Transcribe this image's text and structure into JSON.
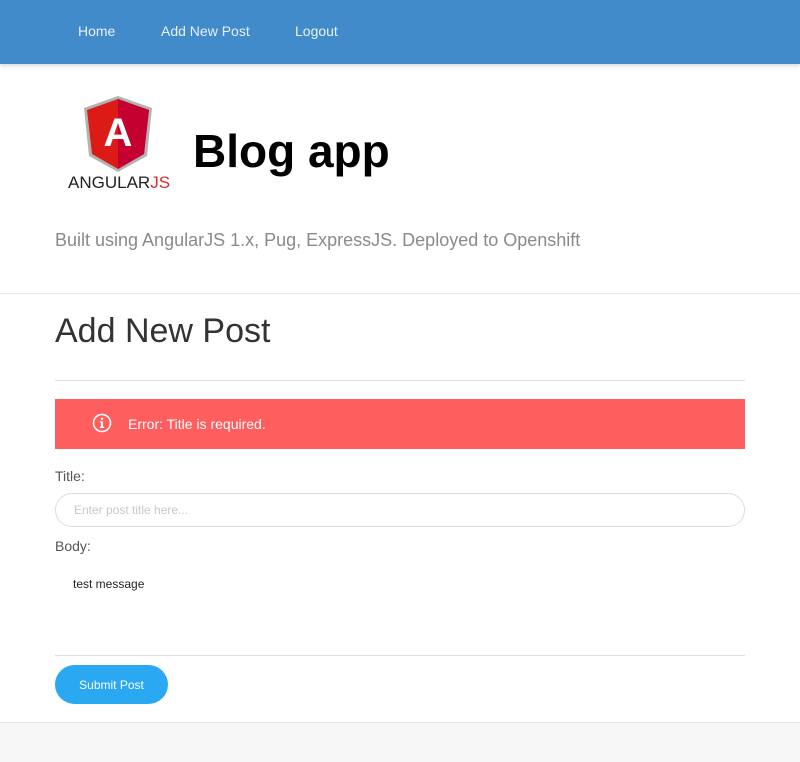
{
  "nav": {
    "items": [
      {
        "label": "Home"
      },
      {
        "label": "Add New Post"
      },
      {
        "label": "Logout"
      }
    ]
  },
  "header": {
    "logo_text_main": "ANGULAR",
    "logo_text_accent": "JS",
    "logo_glyph": "A",
    "title": "Blog app",
    "tagline": "Built using AngularJS 1.x, Pug, ExpressJS. Deployed to Openshift"
  },
  "main": {
    "heading": "Add New Post",
    "alert": {
      "icon": "info-circle-icon",
      "text": "Error: Title is required.",
      "color": "#ff5e5e"
    },
    "form": {
      "title_label": "Title:",
      "title_placeholder": "Enter post title here...",
      "title_value": "",
      "body_label": "Body:",
      "body_value": "test message",
      "submit_label": "Submit Post"
    }
  },
  "colors": {
    "navbar": "#428bca",
    "button": "#2aa9f2",
    "angular_red": "#dd1b16"
  }
}
